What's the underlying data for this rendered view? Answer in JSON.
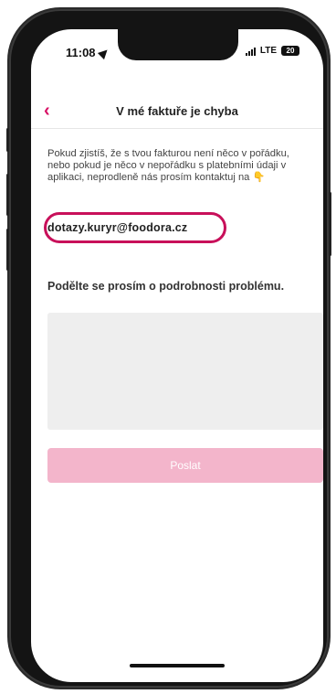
{
  "status_bar": {
    "time": "11:08",
    "network": "LTE",
    "battery": "20"
  },
  "header": {
    "back_icon": "chevron-left-icon",
    "title": "V mé faktuře je chyba"
  },
  "info": {
    "text": "Pokud zjistíš, že s tvou fakturou není něco v pořádku, nebo pokud je něco v nepořádku s platebními údaji v aplikaci, neprodleně nás prosím kontaktuj na",
    "hand_icon": "pointing-down-hand-icon",
    "email": "dotazy.kuryr@foodora.cz"
  },
  "form": {
    "prompt": "Podělte se prosím o podrobnosti problému.",
    "textarea_value": "",
    "submit_label": "Poslat"
  },
  "colors": {
    "accent": "#d70f64",
    "highlight_ring": "#c8105a",
    "button_disabled": "#f3b5cb",
    "textarea_bg": "#eeeeee"
  }
}
